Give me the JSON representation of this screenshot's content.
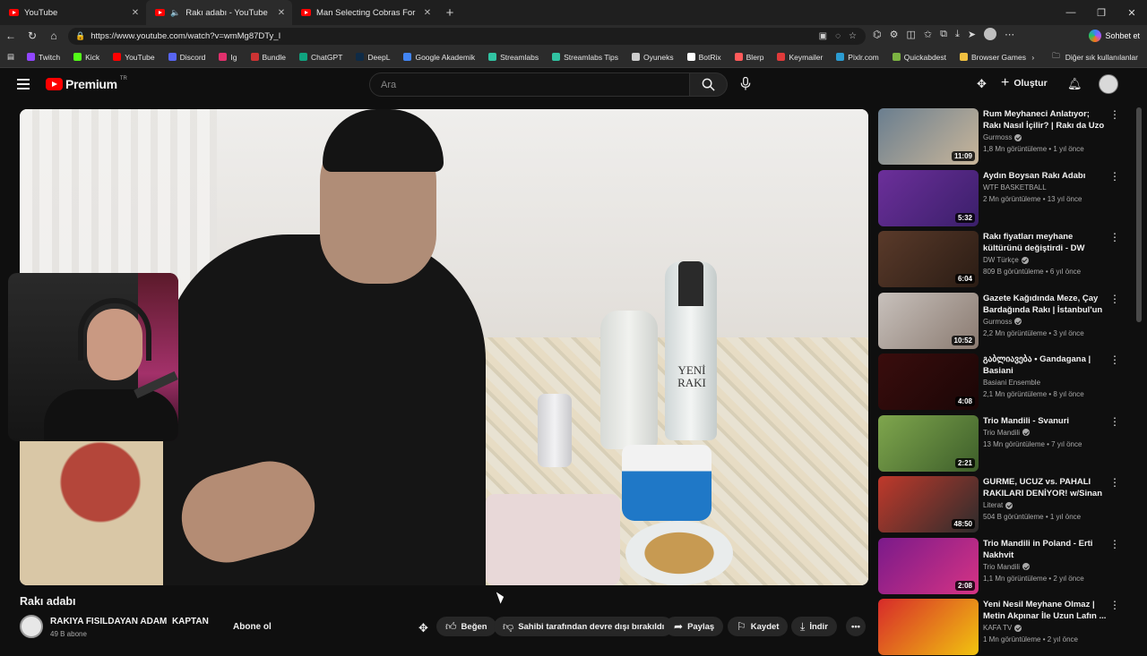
{
  "browser": {
    "tabs": [
      {
        "title": "YouTube"
      },
      {
        "title": "Rakı adabı - YouTube"
      },
      {
        "title": "Man Selecting Cobras For Snake S"
      }
    ],
    "url": "https://www.youtube.com/watch?v=wmMg87DTy_I",
    "copilot_label": "Sohbet et",
    "bookmarks": [
      "Twitch",
      "Kick",
      "YouTube",
      "Discord",
      "Ig",
      "Bundle",
      "ChatGPT",
      "DeepL",
      "Google Akademik",
      "Streamlabs",
      "Streamlabs Tips",
      "Oyuneks",
      "BotRix",
      "Blerp",
      "Keymailer",
      "Pixlr.com",
      "Quickabdest",
      "Browser Games"
    ],
    "bookmark_colors": [
      "#9146ff",
      "#53fc18",
      "#ff0000",
      "#5865f2",
      "#e1306c",
      "#cc3333",
      "#10a37f",
      "#0f2b46",
      "#4285f4",
      "#31c3a2",
      "#31c3a2",
      "#cccccc",
      "#ffffff",
      "#ff5a5a",
      "#e03a3a",
      "#2b9bd1",
      "#7cb342",
      "#f0c040"
    ],
    "other_favorites": "Diğer sık kullanılanlar"
  },
  "youtube": {
    "logo_text": "Premium",
    "region": "TR",
    "search_placeholder": "Ara",
    "create_label": "Oluştur"
  },
  "video": {
    "title": "Rakı adabı",
    "bottle_label": "YENİ RAKI",
    "channel_name": "RAKIYA FISILDAYAN ADAM  KAPTAN",
    "subscribers": "49 B abone",
    "subscribe_label": "Abone ol",
    "actions": {
      "like": "Beğen",
      "dislike": "Sahibi tarafından devre dışı bırakıldı",
      "share": "Paylaş",
      "save": "Kaydet",
      "download": "İndir"
    }
  },
  "related": [
    {
      "title": "Rum Meyhaneci Anlatıyor; Rakı Nasıl İçilir? | Rakı da Uzo da ...",
      "channel": "Gurmoss",
      "verified": true,
      "stats": "1,8 Mn görüntüleme • 1 yıl önce",
      "duration": "11:09",
      "colors": [
        "#6a7e8f",
        "#c9b69a"
      ]
    },
    {
      "title": "Aydın Boysan Rakı Adabı",
      "channel": "WTF BASKETBALL",
      "verified": false,
      "stats": "2 Mn görüntüleme • 13 yıl önce",
      "duration": "5:32",
      "colors": [
        "#6c2f9a",
        "#3a1f6a"
      ]
    },
    {
      "title": "Rakı fiyatları meyhane kültürünü değiştirdi - DW Türkçe",
      "channel": "DW Türkçe",
      "verified": true,
      "stats": "809 B görüntüleme • 6 yıl önce",
      "duration": "6:04",
      "colors": [
        "#5a3a2a",
        "#2a1c14"
      ]
    },
    {
      "title": "Gazete Kağıdında Meze, Çay Bardağında Rakı | İstanbul'un İ...",
      "channel": "Gurmoss",
      "verified": true,
      "stats": "2,2 Mn görüntüleme • 3 yıl önce",
      "duration": "10:52",
      "colors": [
        "#c8c1bc",
        "#8a7a70"
      ]
    },
    {
      "title": "გაბლიავება • Gandagana | Basiani",
      "channel": "Basiani Ensemble",
      "verified": false,
      "stats": "2,1 Mn görüntüleme • 8 yıl önce",
      "duration": "4:08",
      "colors": [
        "#3a0d0d",
        "#1a0606"
      ]
    },
    {
      "title": "Trio Mandili - Svanuri",
      "channel": "Trio Mandili",
      "verified": true,
      "stats": "13 Mn görüntüleme • 7 yıl önce",
      "duration": "2:21",
      "colors": [
        "#7fa64d",
        "#3d5e2a"
      ]
    },
    {
      "title": "GURME, UCUZ vs. PAHALI RAKILARI DENİYOR! w/Sinan ...",
      "channel": "Literat",
      "verified": true,
      "stats": "504 B görüntüleme • 1 yıl önce",
      "duration": "48:50",
      "colors": [
        "#c0392b",
        "#2c2c2c"
      ]
    },
    {
      "title": "Trio Mandili in Poland - Erti Nakhvit",
      "channel": "Trio Mandili",
      "verified": true,
      "stats": "1,1 Mn görüntüleme • 2 yıl önce",
      "duration": "2:08",
      "colors": [
        "#7a1a8a",
        "#d63384"
      ]
    },
    {
      "title": "Yeni Nesil Meyhane Olmaz | Metin Akpınar İle Uzun Lafın ...",
      "channel": "KAFA TV",
      "verified": true,
      "stats": "1 Mn görüntüleme • 2 yıl önce",
      "duration": "",
      "colors": [
        "#d72a2a",
        "#f1c40f"
      ]
    }
  ]
}
